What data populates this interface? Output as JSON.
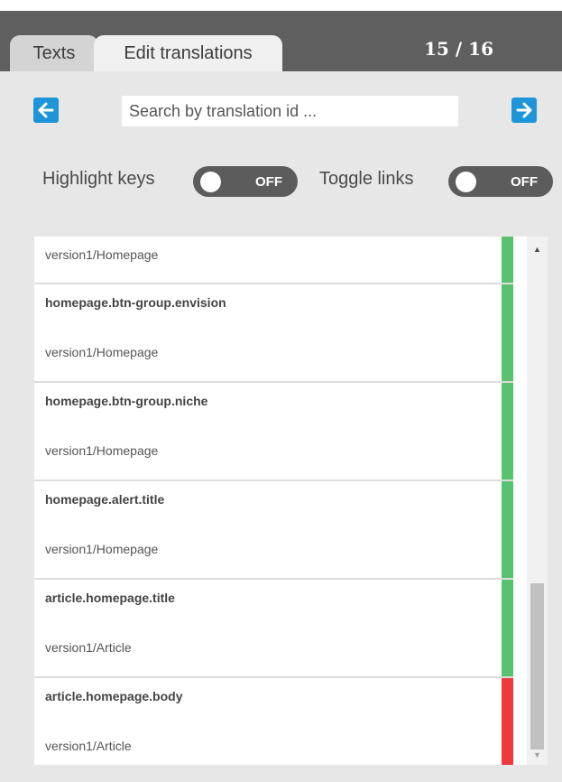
{
  "tabs": [
    {
      "label": "Texts"
    },
    {
      "label": "Edit translations"
    }
  ],
  "counter": "15 / 16",
  "search": {
    "placeholder": "Search by translation id ..."
  },
  "toggles": {
    "highlight_keys": {
      "label": "Highlight keys",
      "state": "OFF"
    },
    "toggle_links": {
      "label": "Toggle links",
      "state": "OFF"
    }
  },
  "icons": {
    "prev": "arrow-left-icon",
    "next": "arrow-right-icon",
    "scroll_up": "scroll-up-arrow-icon",
    "scroll_down": "scroll-down-arrow-icon"
  },
  "colors": {
    "accent": "#1e95d8",
    "header_bg": "#5f5f5f",
    "status_ok": "#57c36e",
    "status_missing": "#ee3a3a"
  },
  "items": [
    {
      "key": "",
      "path": "version1/Homepage",
      "status": "ok"
    },
    {
      "key": "homepage.btn-group.envision",
      "path": "version1/Homepage",
      "status": "ok"
    },
    {
      "key": "homepage.btn-group.niche",
      "path": "version1/Homepage",
      "status": "ok"
    },
    {
      "key": "homepage.alert.title",
      "path": "version1/Homepage",
      "status": "ok"
    },
    {
      "key": "article.homepage.title",
      "path": "version1/Article",
      "status": "ok"
    },
    {
      "key": "article.homepage.body",
      "path": "version1/Article",
      "status": "missing"
    }
  ]
}
